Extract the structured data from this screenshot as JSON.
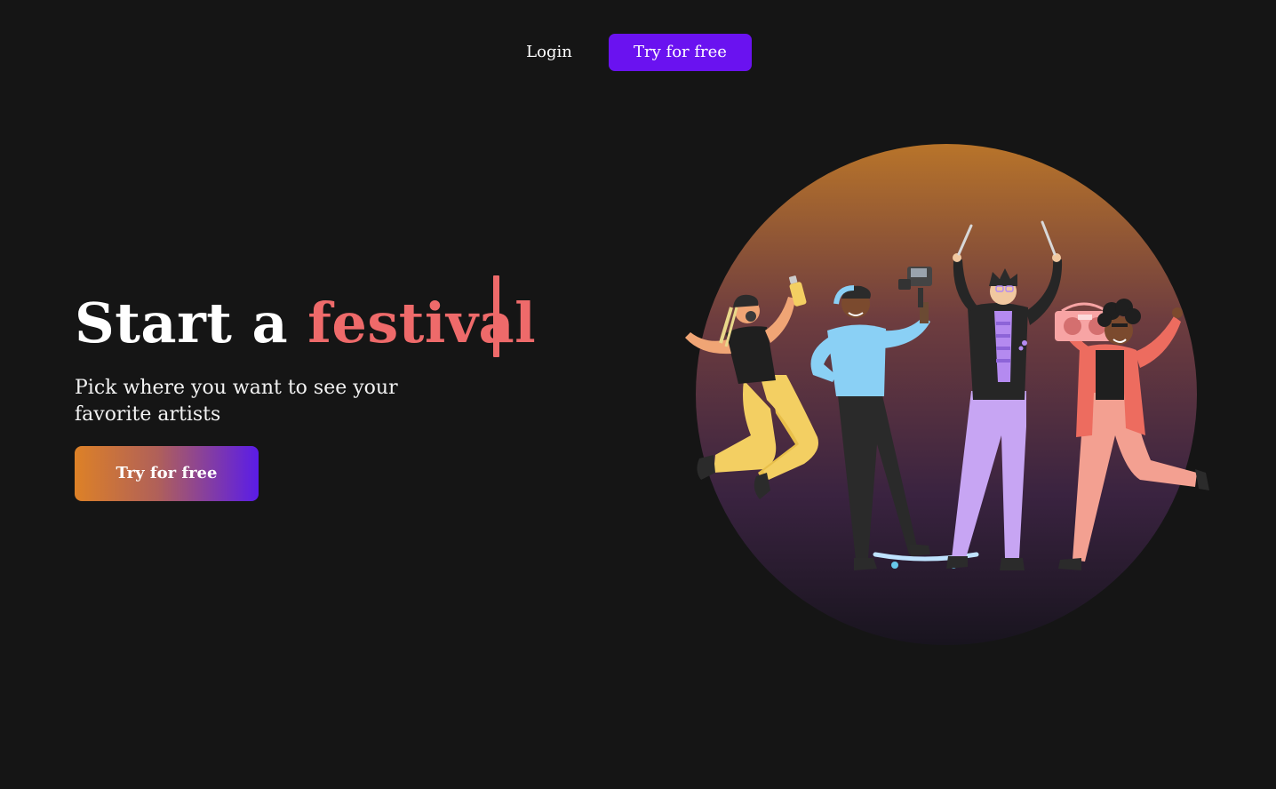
{
  "nav": {
    "login_label": "Login",
    "try_label": "Try for free"
  },
  "hero": {
    "title_lead": "Start a ",
    "title_word": "festival",
    "subtitle": "Pick where you want to see your favorite artists",
    "cta_label": "Try for free"
  },
  "colors": {
    "background": "#151515",
    "accent_purple": "#6a12f0",
    "accent_coral": "#ee6a6a",
    "cta_gradient_start": "#dd8127",
    "cta_gradient_end": "#5a1ce8"
  },
  "illustration": {
    "name": "festival-crowd-illustration",
    "characters": [
      "spray-paint-dancer",
      "camera-operator",
      "drummer",
      "boombox-dancer"
    ]
  }
}
